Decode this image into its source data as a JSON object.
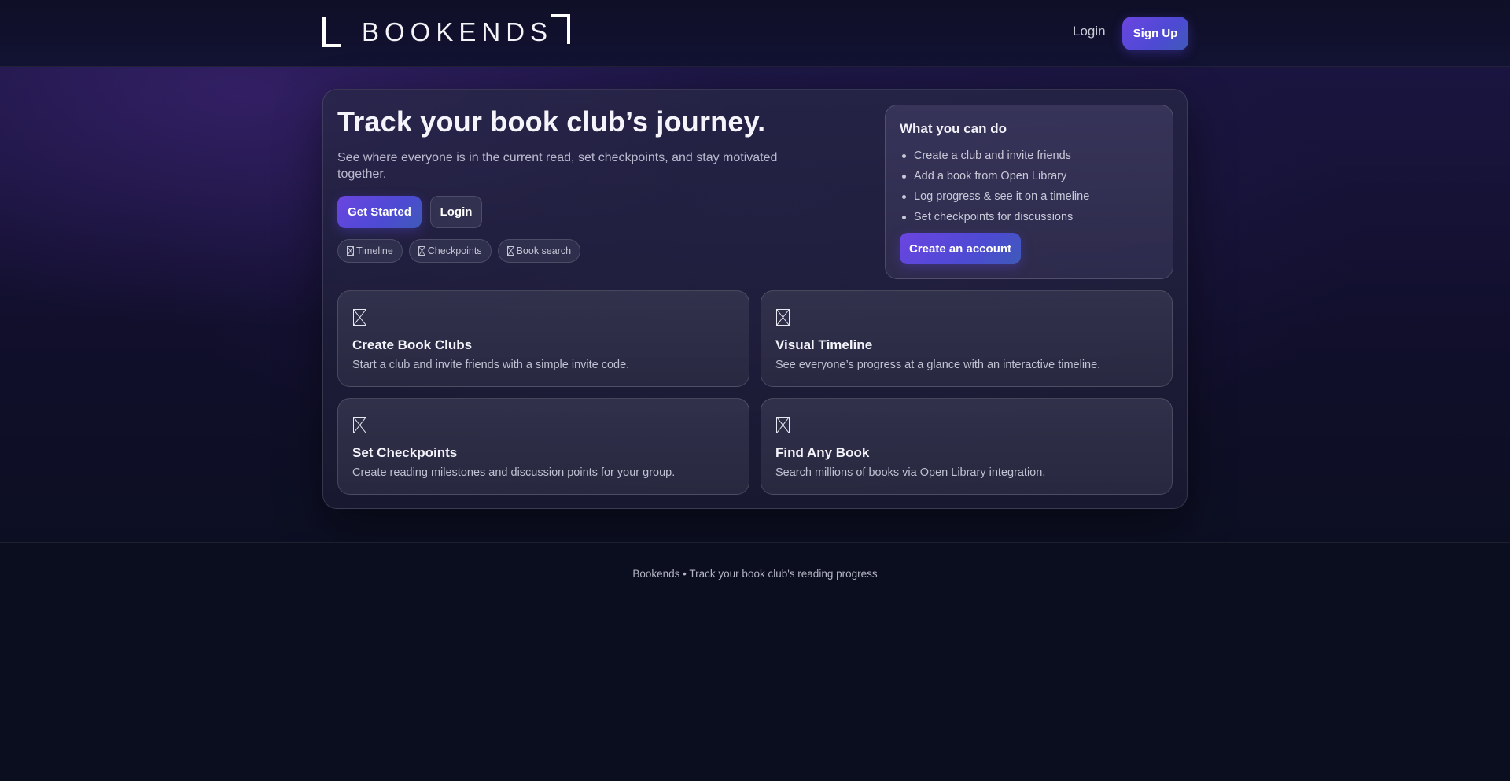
{
  "header": {
    "logo_text": "BOOKENDS",
    "login_label": "Login",
    "signup_label": "Sign Up"
  },
  "hero": {
    "title": "Track your book club’s journey.",
    "subtitle": "See where everyone is in the current read, set checkpoints, and stay motivated together.",
    "primary_button": "Get Started",
    "secondary_button": "Login",
    "chips": [
      {
        "label": "Timeline",
        "icon": "missing-glyph-icon"
      },
      {
        "label": "Checkpoints",
        "icon": "missing-glyph-icon"
      },
      {
        "label": "Book search",
        "icon": "missing-glyph-icon"
      }
    ]
  },
  "side_panel": {
    "title": "What you can do",
    "items": [
      "Create a club and invite friends",
      "Add a book from Open Library",
      "Log progress & see it on a timeline",
      "Set checkpoints for discussions"
    ],
    "button": "Create an account"
  },
  "features": [
    {
      "title": "Create Book Clubs",
      "description": "Start a club and invite friends with a simple invite code.",
      "icon": "missing-glyph-icon"
    },
    {
      "title": "Visual Timeline",
      "description": "See everyone’s progress at a glance with an interactive timeline.",
      "icon": "missing-glyph-icon"
    },
    {
      "title": "Set Checkpoints",
      "description": "Create reading milestones and discussion points for your group.",
      "icon": "missing-glyph-icon"
    },
    {
      "title": "Find Any Book",
      "description": "Search millions of books via Open Library integration.",
      "icon": "missing-glyph-icon"
    }
  ],
  "footer": {
    "text": "Bookends • Track your book club's reading progress"
  },
  "colors": {
    "accent_start": "#6b45e0",
    "accent_end": "#3f5ab8",
    "background": "#0c0f1f"
  }
}
